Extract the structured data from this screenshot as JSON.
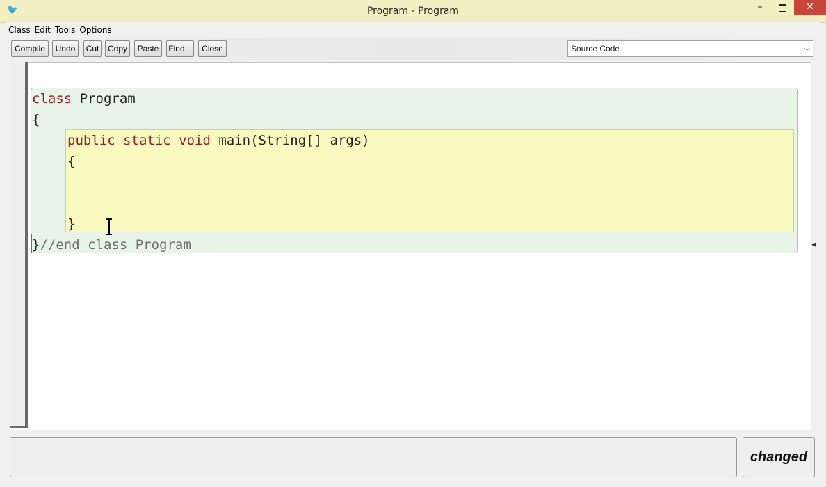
{
  "window": {
    "title": "Program - Program",
    "icon": "bluej-bird-icon",
    "close_label": "✕",
    "minimize_label": "–"
  },
  "menu": {
    "items": [
      "Class",
      "Edit",
      "Tools",
      "Options"
    ]
  },
  "toolbar": {
    "buttons": [
      "Compile",
      "Undo",
      "Cut",
      "Copy",
      "Paste",
      "Find...",
      "Close"
    ],
    "view_select": "Source Code"
  },
  "editor": {
    "lines": {
      "class_kw": "class",
      "class_name": " Program",
      "open_brace_1": "{",
      "method_kw1": "public",
      "method_kw2": " static",
      "method_kw3": " void",
      "method_sig": " main(String[] args)",
      "open_brace_2": "{",
      "close_brace_2": "}",
      "close_brace_1": "}",
      "end_comment": "//end class Program"
    },
    "colors": {
      "keyword": "#9b1c2a",
      "class_scope_bg": "#e8f4e8",
      "method_scope_bg": "#fafac0"
    }
  },
  "status": {
    "message": "",
    "state": "changed"
  }
}
